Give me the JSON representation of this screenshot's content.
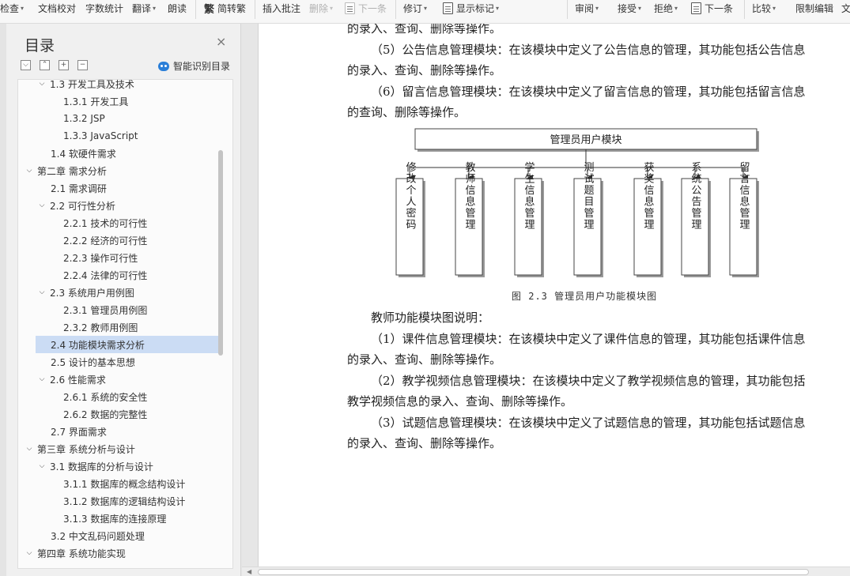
{
  "toolbar": {
    "items": [
      {
        "label": "检查",
        "caret": true,
        "disabled": false
      },
      {
        "label": "文档校对",
        "caret": false,
        "disabled": false
      },
      {
        "label": "字数统计",
        "caret": false,
        "disabled": false
      },
      {
        "label": "翻译",
        "caret": true,
        "disabled": false
      },
      {
        "label": "朗读",
        "caret": false,
        "disabled": false
      },
      {
        "label": "简转繁",
        "caret": false,
        "disabled": false,
        "icon": "traditional-chinese-icon",
        "icon_glyph": "繁"
      },
      {
        "label": "插入批注",
        "caret": false,
        "disabled": false
      },
      {
        "label": "删除",
        "caret": true,
        "disabled": true
      },
      {
        "label": "下一条",
        "caret": false,
        "disabled": true,
        "icon": "next-comment-icon"
      },
      {
        "label": "修订",
        "caret": true,
        "disabled": false
      },
      {
        "label": "显示标记",
        "caret": true,
        "disabled": false,
        "icon": "show-markup-icon"
      },
      {
        "label": "审阅",
        "caret": true,
        "disabled": false
      },
      {
        "label": "接受",
        "caret": true,
        "disabled": false
      },
      {
        "label": "拒绝",
        "caret": true,
        "disabled": false
      },
      {
        "label": "下一条",
        "caret": false,
        "disabled": false,
        "icon": "next-change-icon"
      },
      {
        "label": "比较",
        "caret": true,
        "disabled": false
      },
      {
        "label": "限制编辑",
        "caret": false,
        "disabled": false
      },
      {
        "label": "文",
        "caret": false,
        "disabled": false
      }
    ]
  },
  "sidebar": {
    "title": "目录",
    "close_glyph": "×",
    "buttons": [
      "⌵",
      "⌃",
      "+",
      "−"
    ],
    "smart_toc_label": "智能识别目录",
    "items": [
      {
        "label": "1.3 开发工具及技术",
        "level": 2,
        "expand": "open"
      },
      {
        "label": "1.3.1 开发工具",
        "level": 3,
        "expand": "none"
      },
      {
        "label": "1.3.2 JSP",
        "level": 3,
        "expand": "none"
      },
      {
        "label": "1.3.3 JavaScript",
        "level": 3,
        "expand": "none"
      },
      {
        "label": "1.4 软硬件需求",
        "level": 2,
        "expand": "none"
      },
      {
        "label": "第二章 需求分析",
        "level": 1,
        "expand": "open"
      },
      {
        "label": "2.1 需求调研",
        "level": 2,
        "expand": "none"
      },
      {
        "label": "2.2 可行性分析",
        "level": 2,
        "expand": "open"
      },
      {
        "label": "2.2.1 技术的可行性",
        "level": 3,
        "expand": "none"
      },
      {
        "label": "2.2.2 经济的可行性",
        "level": 3,
        "expand": "none"
      },
      {
        "label": "2.2.3 操作可行性",
        "level": 3,
        "expand": "none"
      },
      {
        "label": "2.2.4 法律的可行性",
        "level": 3,
        "expand": "none"
      },
      {
        "label": "2.3 系统用户用例图",
        "level": 2,
        "expand": "open"
      },
      {
        "label": "2.3.1 管理员用例图",
        "level": 3,
        "expand": "none"
      },
      {
        "label": "2.3.2 教师用例图",
        "level": 3,
        "expand": "none"
      },
      {
        "label": "2.4 功能模块需求分析",
        "level": 2,
        "expand": "none",
        "selected": true
      },
      {
        "label": "2.5 设计的基本思想",
        "level": 2,
        "expand": "none"
      },
      {
        "label": "2.6 性能需求",
        "level": 2,
        "expand": "open"
      },
      {
        "label": "2.6.1 系统的安全性",
        "level": 3,
        "expand": "none"
      },
      {
        "label": "2.6.2 数据的完整性",
        "level": 3,
        "expand": "none"
      },
      {
        "label": "2.7 界面需求",
        "level": 2,
        "expand": "none"
      },
      {
        "label": "第三章 系统分析与设计",
        "level": 1,
        "expand": "open"
      },
      {
        "label": "3.1 数据库的分析与设计",
        "level": 2,
        "expand": "open"
      },
      {
        "label": "3.1.1 数据库的概念结构设计",
        "level": 3,
        "expand": "none"
      },
      {
        "label": "3.1.2 数据库的逻辑结构设计",
        "level": 3,
        "expand": "none"
      },
      {
        "label": "3.1.3 数据库的连接原理",
        "level": 3,
        "expand": "none"
      },
      {
        "label": "3.2 中文乱码问题处理",
        "level": 2,
        "expand": "none"
      },
      {
        "label": "第四章 系统功能实现",
        "level": 1,
        "expand": "open"
      }
    ]
  },
  "document": {
    "paragraphs_top": [
      "的录入、查询、删除等操作。",
      "（5）公告信息管理模块：在该模块中定义了公告信息的管理，其功能包括公告信息",
      "的录入、查询、删除等操作。",
      "（6）留言信息管理模块：在该模块中定义了留言信息的管理，其功能包括留言信息",
      "的查询、删除等操作。"
    ],
    "diagram": {
      "root": "管理员用户模块",
      "children": [
        "修改个人密码",
        "教师信息管理",
        "学生信息管理",
        "测试题目管理",
        "获奖信息管理",
        "系统公告管理",
        "留言信息管理"
      ]
    },
    "caption": "图 2.3 管理员用户功能模块图",
    "paragraphs_bottom": [
      "教师功能模块图说明：",
      "（1）课件信息管理模块：在该模块中定义了课件信息的管理，其功能包括课件信息",
      "的录入、查询、删除等操作。",
      "（2）教学视频信息管理模块：在该模块中定义了教学视频信息的管理，其功能包括",
      "教学视频信息的录入、查询、删除等操作。",
      "（3）试题信息管理模块：在该模块中定义了试题信息的管理，其功能包括试题信息",
      "的录入、查询、删除等操作。"
    ]
  }
}
